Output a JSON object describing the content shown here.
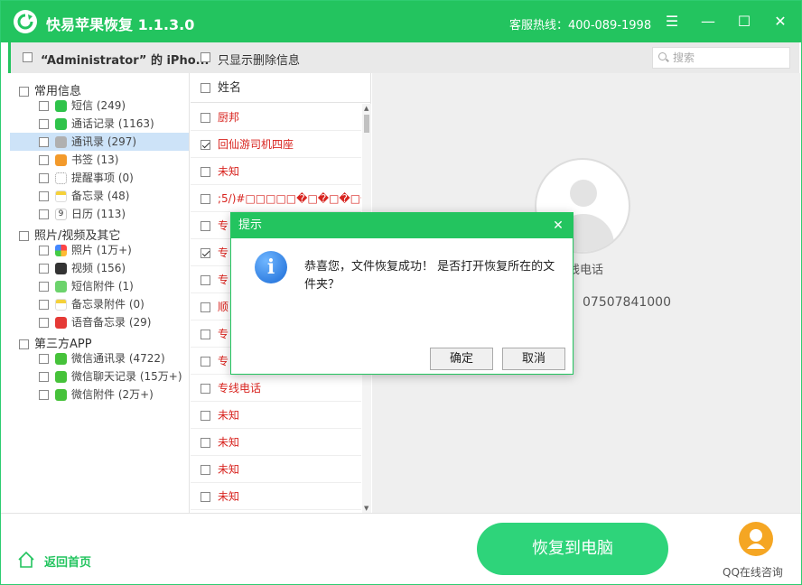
{
  "app": {
    "title": "快易苹果恢复 1.1.3.0",
    "hotline": "客服热线：400-089-1998",
    "accent": "#23c45f"
  },
  "toolbar": {
    "device_name": "“Administrator” 的 iPho...",
    "show_deleted_label": "只显示删除信息",
    "search_placeholder": "搜索"
  },
  "tree": {
    "groups": [
      {
        "label": "常用信息",
        "items": [
          {
            "label": "短信 (249)",
            "icon": "message-icon",
            "color": "#2fc34a"
          },
          {
            "label": "通话记录 (1163)",
            "icon": "phone-icon",
            "color": "#2fc34a"
          },
          {
            "label": "通讯录 (297)",
            "icon": "contacts-icon",
            "color": "#b0b0b0",
            "selected": true
          },
          {
            "label": "书签 (13)",
            "icon": "bookmark-icon",
            "color": "#f39a2b"
          },
          {
            "label": "提醒事项 (0)",
            "icon": "reminder-icon",
            "color": "#dddddd"
          },
          {
            "label": "备忘录 (48)",
            "icon": "notes-icon",
            "color": "#f5d13a"
          },
          {
            "label": "日历 (113)",
            "icon": "calendar-icon",
            "color": "#eeeeee"
          }
        ]
      },
      {
        "label": "照片/视频及其它",
        "items": [
          {
            "label": "照片 (1万+)",
            "icon": "photos-icon",
            "color": "#f0a0c0"
          },
          {
            "label": "视频 (156)",
            "icon": "video-icon",
            "color": "#333333"
          },
          {
            "label": "短信附件 (1)",
            "icon": "attachment-icon",
            "color": "#6cd36c"
          },
          {
            "label": "备忘录附件 (0)",
            "icon": "notes-attachment-icon",
            "color": "#f5d13a"
          },
          {
            "label": "语音备忘录 (29)",
            "icon": "voice-memo-icon",
            "color": "#e53935"
          }
        ]
      },
      {
        "label": "第三方APP",
        "items": [
          {
            "label": "微信通讯录 (4722)",
            "icon": "wechat-icon",
            "color": "#46c23a"
          },
          {
            "label": "微信聊天记录 (15万+)",
            "icon": "wechat-icon",
            "color": "#46c23a"
          },
          {
            "label": "微信附件 (2万+)",
            "icon": "wechat-icon",
            "color": "#46c23a"
          }
        ]
      }
    ]
  },
  "list": {
    "header": "姓名",
    "rows": [
      {
        "name": "厨邦",
        "checked": false
      },
      {
        "name": "回仙游司机四座",
        "checked": true
      },
      {
        "name": "未知",
        "checked": false
      },
      {
        "name": ";5/)#□□□□□�□�□�□�□�",
        "checked": false
      },
      {
        "name": "专",
        "checked": false
      },
      {
        "name": "专",
        "checked": true
      },
      {
        "name": "专",
        "checked": false
      },
      {
        "name": "顺",
        "checked": false
      },
      {
        "name": "专",
        "checked": false
      },
      {
        "name": "专",
        "checked": false
      },
      {
        "name": "专线电话",
        "checked": false
      },
      {
        "name": "未知",
        "checked": false
      },
      {
        "name": "未知",
        "checked": false
      },
      {
        "name": "未知",
        "checked": false
      },
      {
        "name": "未知",
        "checked": false
      }
    ]
  },
  "detail": {
    "name": "线电话",
    "phone": "07507841000"
  },
  "footer": {
    "home_label": "返回首页",
    "recover_label": "恢复到电脑",
    "qq_label": "QQ在线咨询"
  },
  "modal": {
    "title": "提示",
    "message": "恭喜您，文件恢复成功！ 是否打开恢复所在的文件夹？",
    "ok_label": "确定",
    "cancel_label": "取消"
  }
}
